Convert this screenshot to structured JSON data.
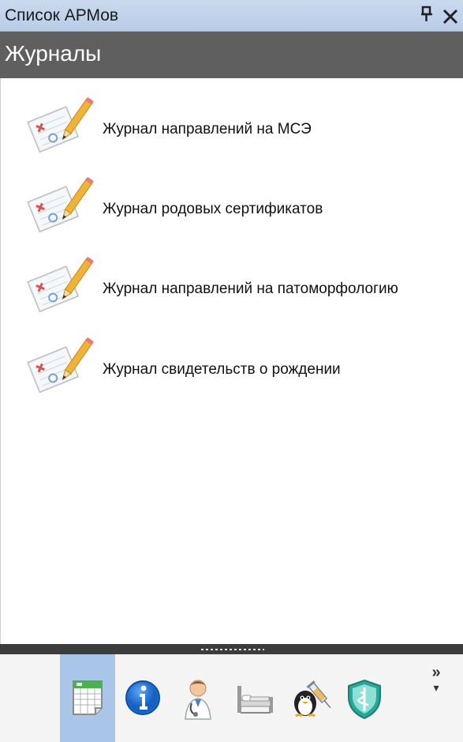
{
  "titlebar": {
    "title": "Список АРМов",
    "pin_glyph": "ꟼ",
    "close_glyph": "✕"
  },
  "header": {
    "title": "Журналы"
  },
  "journals": [
    {
      "label": "Журнал направлений на МСЭ",
      "icon": "journal-edit-icon"
    },
    {
      "label": "Журнал родовых сертификатов",
      "icon": "journal-edit-icon"
    },
    {
      "label": "Журнал направлений на патоморфологию",
      "icon": "journal-edit-icon"
    },
    {
      "label": "Журнал свидетельств о рождении",
      "icon": "journal-edit-icon"
    }
  ],
  "toolbar": {
    "buttons": [
      {
        "icon": "journals-icon",
        "selected": true
      },
      {
        "icon": "info-icon",
        "selected": false
      },
      {
        "icon": "doctor-icon",
        "selected": false
      },
      {
        "icon": "hospital-bed-icon",
        "selected": false
      },
      {
        "icon": "vaccination-icon",
        "selected": false
      },
      {
        "icon": "medical-shield-icon",
        "selected": false
      }
    ],
    "more_glyph": "»"
  }
}
